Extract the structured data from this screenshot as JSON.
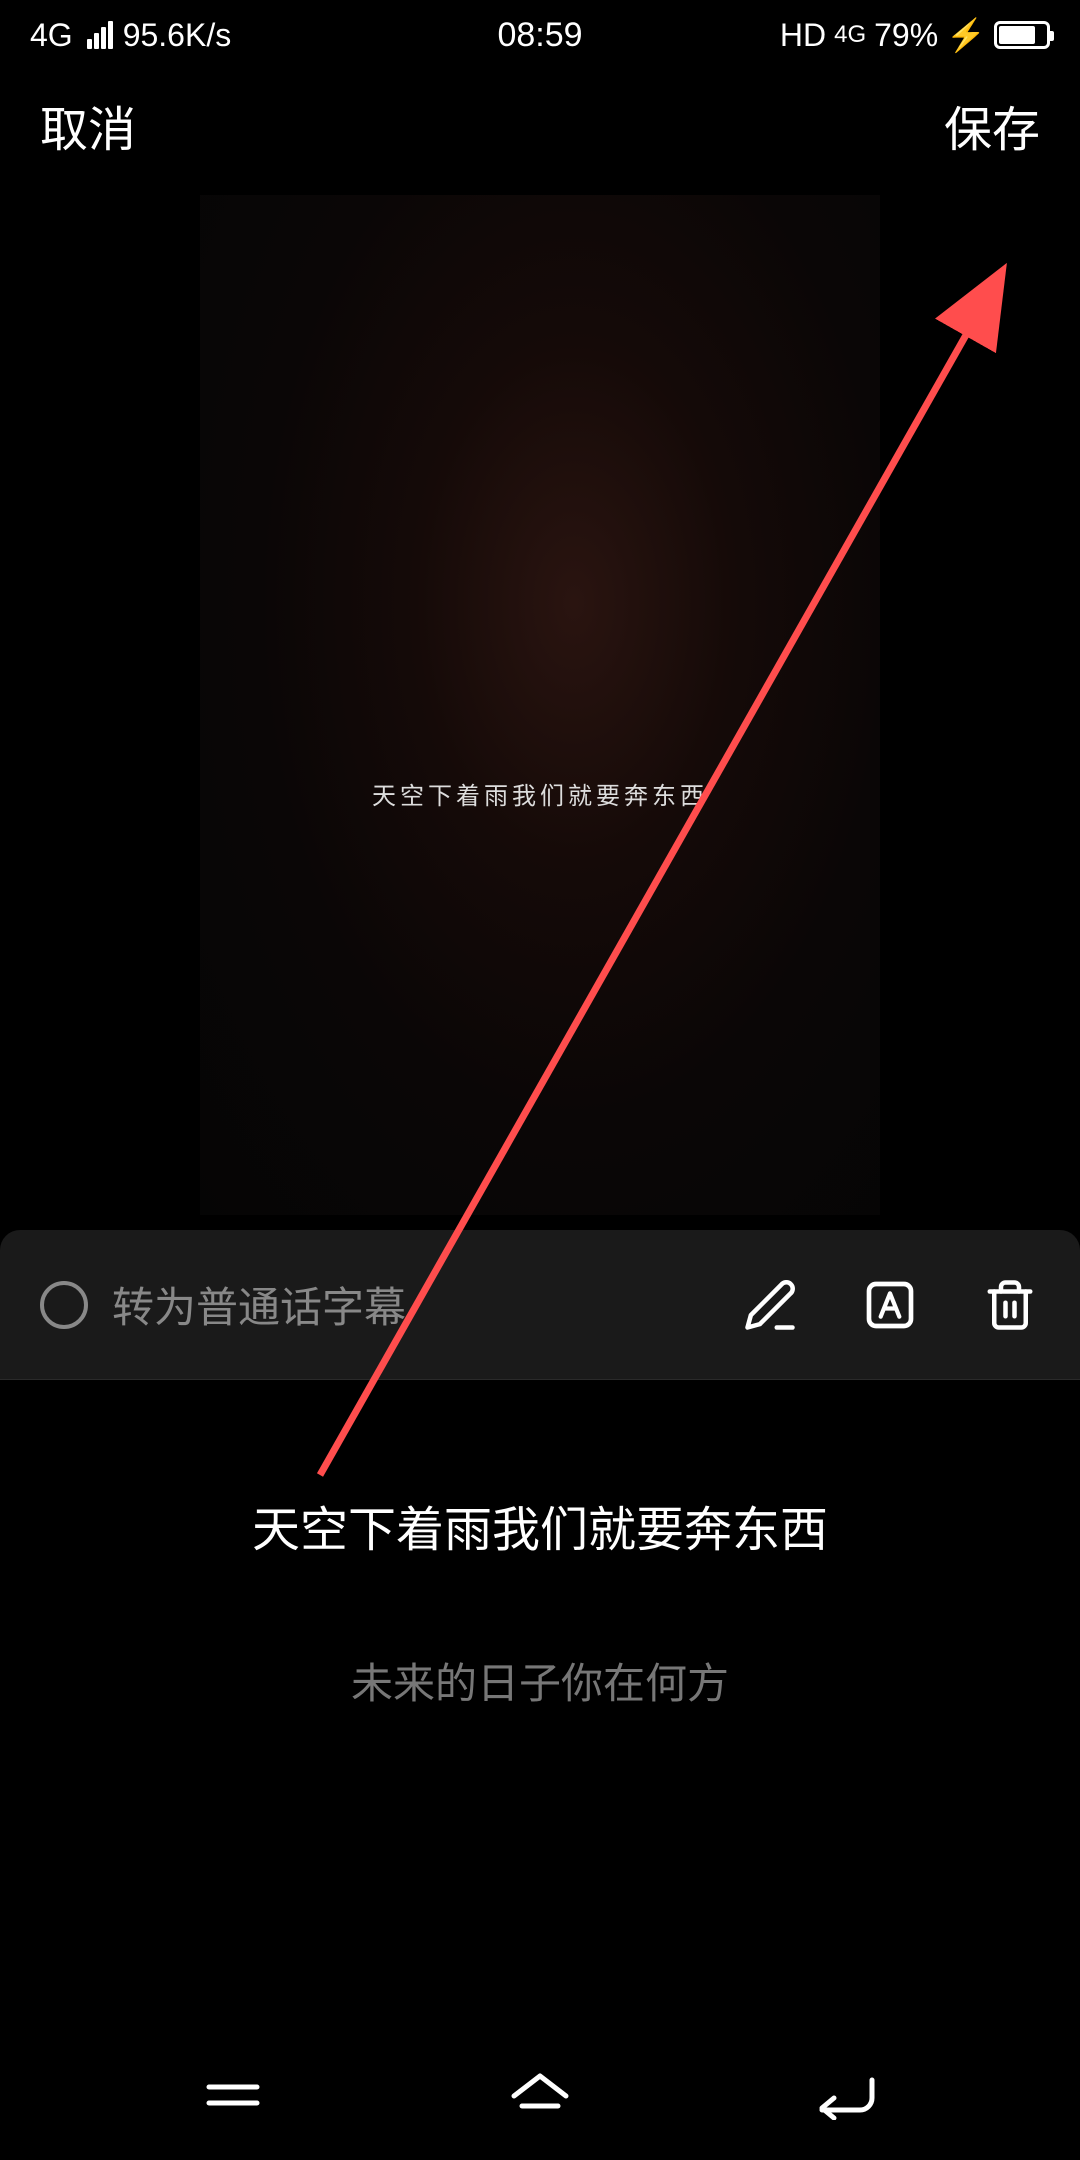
{
  "statusBar": {
    "network": "4G",
    "speed": "95.6K/s",
    "time": "08:59",
    "hd": "HD",
    "networkIcon": "4G",
    "battery": "79%",
    "charging": "⚡"
  },
  "header": {
    "cancel": "取消",
    "save": "保存"
  },
  "preview": {
    "subtitle": "天空下着雨我们就要奔东西"
  },
  "toolbar": {
    "convertLabel": "转为普通话字幕"
  },
  "lyrics": {
    "current": "天空下着雨我们就要奔东西",
    "next": "未来的日子你在何方"
  },
  "annotation": {
    "color": "#ff4d4d"
  }
}
